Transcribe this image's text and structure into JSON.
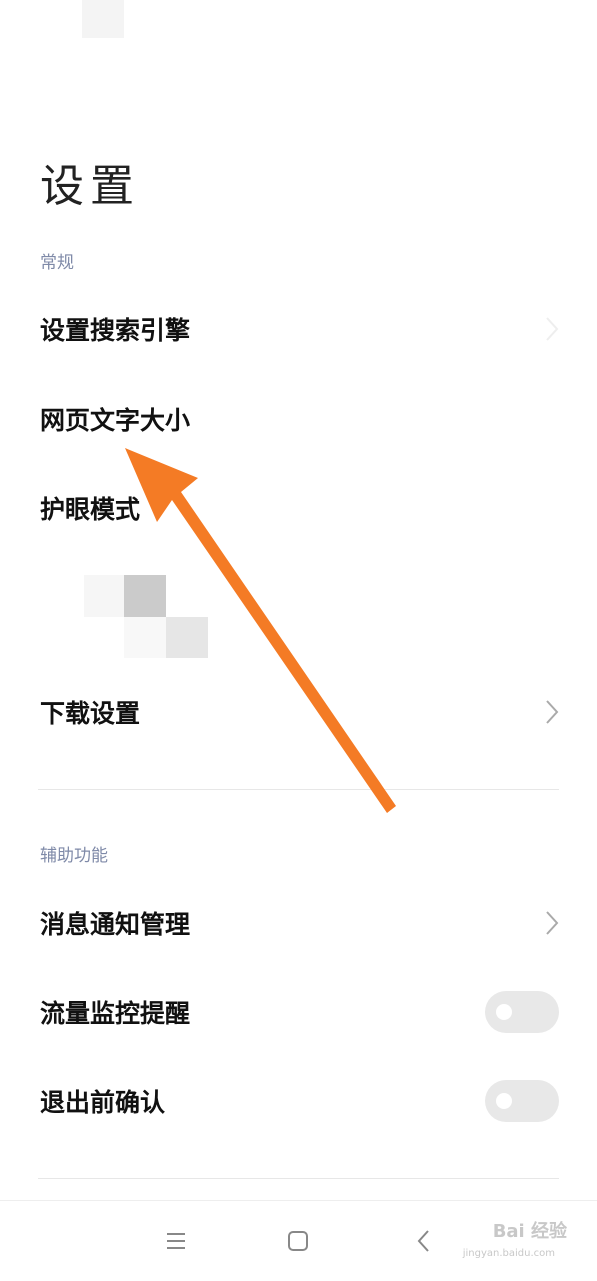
{
  "page": {
    "title": "设置"
  },
  "sections": {
    "general": {
      "label": "常规",
      "items": [
        {
          "label": "设置搜索引擎"
        },
        {
          "label": "网页文字大小"
        },
        {
          "label": "护眼模式"
        },
        {
          "label": "下载设置"
        }
      ]
    },
    "accessibility": {
      "label": "辅助功能",
      "items": [
        {
          "label": "消息通知管理"
        },
        {
          "label": "流量监控提醒",
          "toggle_on": false
        },
        {
          "label": "退出前确认",
          "toggle_on": false
        }
      ]
    }
  },
  "navbar": {
    "buttons": [
      "menu-icon",
      "home-icon",
      "back-icon"
    ]
  },
  "watermark": {
    "text": "Bai 经验",
    "sub": "jingyan.baidu.com"
  },
  "annotation": {
    "arrow_color": "#f47b25"
  },
  "colors": {
    "section_label": "#7f8aa8",
    "toggle_off": "#e8e8e8"
  }
}
